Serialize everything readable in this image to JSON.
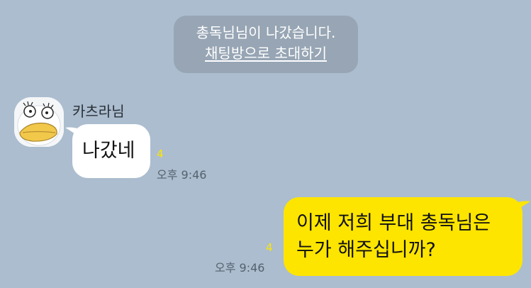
{
  "system_notice": {
    "left_text": "총독님님이 나갔습니다.",
    "invite_link": "채팅방으로 초대하기"
  },
  "incoming": {
    "sender_name": "카츠라님",
    "avatar_icon": "duck-avatar-icon",
    "text": "나갔네",
    "unread_count": "4",
    "time": "오후 9:46"
  },
  "outgoing": {
    "line1": "이제 저희 부대 총독님은",
    "line2": "누가 해주십니까?",
    "unread_count": "4",
    "time": "오후 9:46"
  },
  "colors": {
    "background": "#abbdcf",
    "my_bubble": "#fee500",
    "their_bubble": "#ffffff",
    "notice_bg": "#97a5b4",
    "unread": "#fee500"
  }
}
